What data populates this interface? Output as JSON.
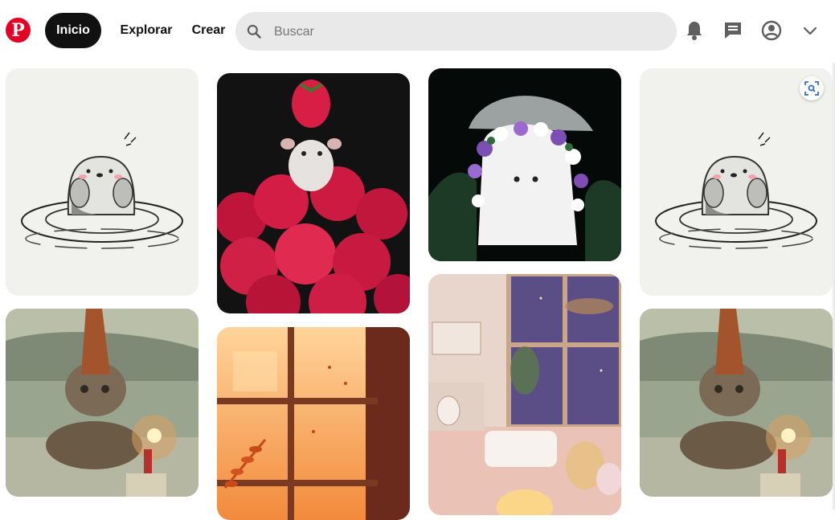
{
  "app": {
    "brand_color": "#e60023"
  },
  "header": {
    "logo_letter": "P",
    "nav": [
      {
        "label": "Inicio",
        "active": true
      },
      {
        "label": "Explorar"
      },
      {
        "label": "Crear"
      }
    ],
    "search": {
      "placeholder": "Buscar",
      "value": ""
    },
    "icons": [
      "bell-icon",
      "message-icon",
      "profile-icon",
      "chevron-down-icon"
    ]
  },
  "feed": {
    "pins": [
      {
        "column": 1,
        "subject": "otter-sketch"
      },
      {
        "column": 1,
        "subject": "cat-party-hat"
      },
      {
        "column": 2,
        "subject": "mouse-raspberries"
      },
      {
        "column": 2,
        "subject": "autumn-window"
      },
      {
        "column": 3,
        "subject": "ghost-flowers"
      },
      {
        "column": 3,
        "subject": "cozy-room"
      },
      {
        "column": 4,
        "subject": "otter-sketch"
      },
      {
        "column": 4,
        "subject": "cat-party-hat"
      }
    ],
    "visual_search_icon": "lens-icon"
  }
}
